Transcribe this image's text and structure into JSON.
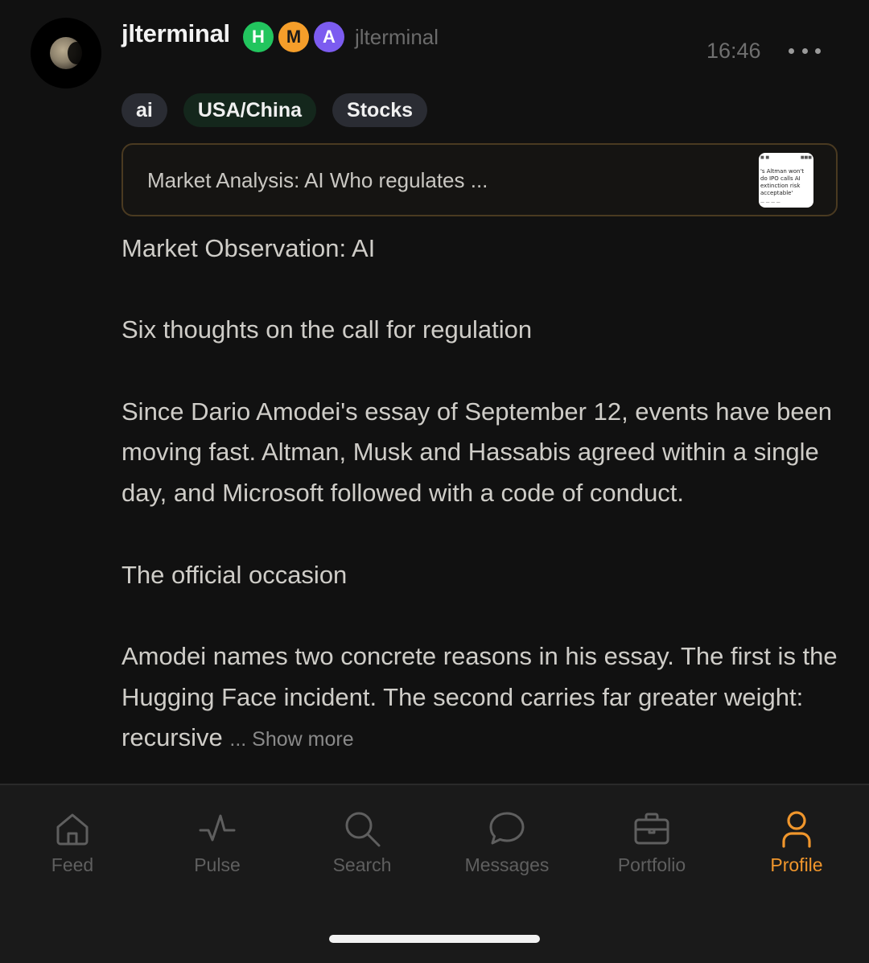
{
  "post": {
    "username": "jlterminal",
    "badges": [
      "H",
      "M",
      "A"
    ],
    "handle": "jlterminal",
    "time": "16:46",
    "tags": [
      "ai",
      "USA/China",
      "Stocks"
    ],
    "link_card": {
      "title": "Market Analysis: AI Who regulates ...",
      "thumbnail_headline": "'s Altman won't do IPO calls AI extinction risk acceptable'"
    },
    "body": {
      "p1": "Market Observation: AI",
      "p2": "Six thoughts on the call for regulation",
      "p3": "Since Dario Amodei's essay of September 12, events have been moving fast. Altman, Musk and Hassabis agreed within a single day, and Microsoft followed with a code of conduct.",
      "p4": "The official occasion",
      "p5": "Amodei names two concrete reasons in his essay. The first is the Hugging Face incident. The second carries far greater weight: recursive",
      "show_more": "... Show more"
    }
  },
  "nav": {
    "items": [
      {
        "label": "Feed",
        "icon": "home-icon"
      },
      {
        "label": "Pulse",
        "icon": "pulse-icon"
      },
      {
        "label": "Search",
        "icon": "search-icon"
      },
      {
        "label": "Messages",
        "icon": "chat-bubble-icon"
      },
      {
        "label": "Portfolio",
        "icon": "briefcase-icon"
      },
      {
        "label": "Profile",
        "icon": "user-icon"
      }
    ],
    "active": "Profile"
  },
  "colors": {
    "background": "#111111",
    "accent": "#f0962c",
    "badge_h": "#22c55e",
    "badge_m": "#f59e2a",
    "badge_a": "#7c5cf0",
    "tag_green_bg": "#14271c"
  }
}
